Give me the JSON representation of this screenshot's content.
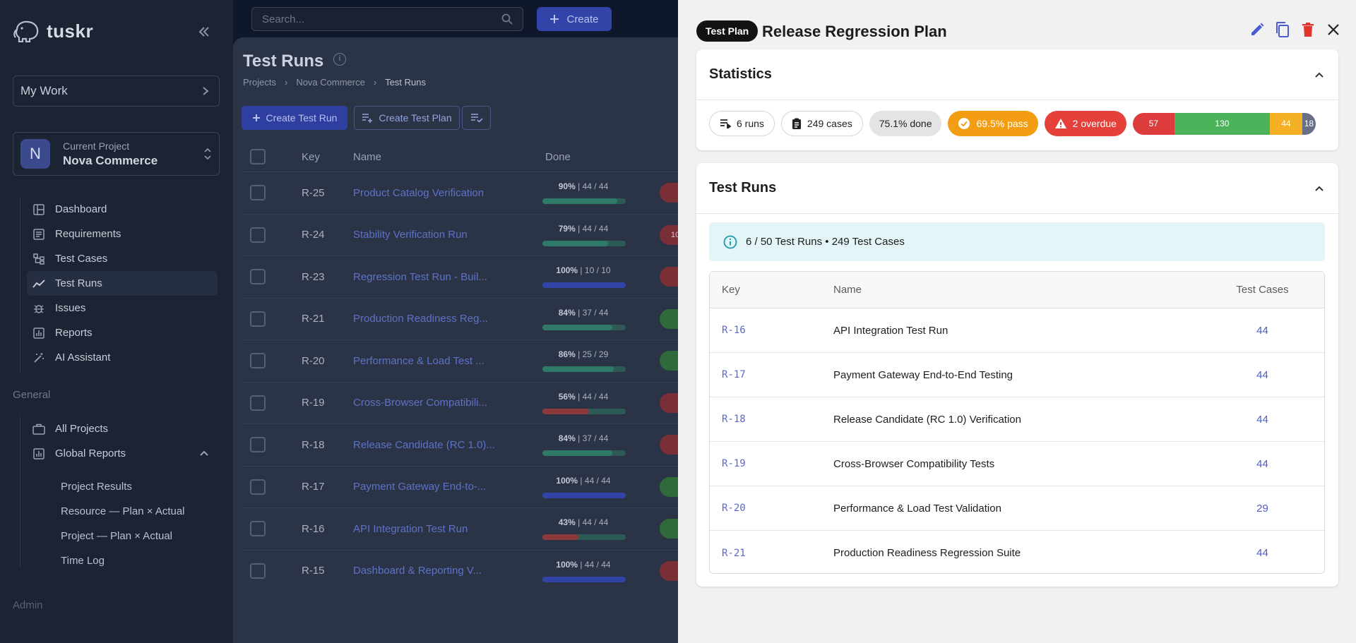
{
  "app": {
    "logo_text": "tuskr"
  },
  "sidebar": {
    "my_work": "My Work",
    "project_label": "Current Project",
    "project_name": "Nova Commerce",
    "project_initial": "N",
    "nav": [
      {
        "label": "Dashboard",
        "icon": "dashboard-icon"
      },
      {
        "label": "Requirements",
        "icon": "requirements-icon"
      },
      {
        "label": "Test Cases",
        "icon": "test-cases-icon"
      },
      {
        "label": "Test Runs",
        "icon": "test-runs-icon",
        "active": true
      },
      {
        "label": "Issues",
        "icon": "bug-icon"
      },
      {
        "label": "Reports",
        "icon": "reports-icon"
      },
      {
        "label": "AI Assistant",
        "icon": "magic-wand-icon"
      }
    ],
    "general_label": "General",
    "general_nav": [
      {
        "label": "All Projects",
        "icon": "briefcase-icon"
      },
      {
        "label": "Global Reports",
        "icon": "reports-icon"
      }
    ],
    "global_reports_sub": [
      "Project Results",
      "Resource — Plan × Actual",
      "Project — Plan × Actual",
      "Time Log"
    ],
    "admin_label": "Admin"
  },
  "topbar": {
    "search_placeholder": "Search...",
    "create_label": "Create"
  },
  "main": {
    "title": "Test Runs",
    "breadcrumb": [
      "Projects",
      "Nova Commerce",
      "Test Runs"
    ],
    "create_test_run": "Create Test Run",
    "create_test_plan": "Create Test Plan",
    "columns": [
      "Key",
      "Name",
      "Done"
    ],
    "runs": [
      {
        "key": "R-25",
        "name": "Product Catalog Verification",
        "pct": "90%",
        "counts": "44 / 44",
        "fill": 0.9,
        "bar_color": "#2f7a66",
        "pill_color": "#7a2e35",
        "pill_text": ""
      },
      {
        "key": "R-24",
        "name": "Stability Verification Run",
        "pct": "79%",
        "counts": "44 / 44",
        "fill": 0.79,
        "bar_color": "#2f7a66",
        "pill_color": "#7a2e35",
        "pill_text": "10"
      },
      {
        "key": "R-23",
        "name": "Regression Test Run - Buil...",
        "pct": "100%",
        "counts": "10 / 10",
        "fill": 1.0,
        "bar_color": "#3243a8",
        "pill_color": "#7a2e35",
        "pill_text": ""
      },
      {
        "key": "R-21",
        "name": "Production Readiness Reg...",
        "pct": "84%",
        "counts": "37 / 44",
        "fill": 0.84,
        "bar_color": "#2f7a66",
        "pill_color": "#2f6a3a",
        "pill_text": ""
      },
      {
        "key": "R-20",
        "name": "Performance & Load Test ...",
        "pct": "86%",
        "counts": "25 / 29",
        "fill": 0.86,
        "bar_color": "#2f7a66",
        "pill_color": "#2f6a3a",
        "pill_text": ""
      },
      {
        "key": "R-19",
        "name": "Cross-Browser Compatibili...",
        "pct": "56%",
        "counts": "44 / 44",
        "fill": 0.56,
        "bar_color": "#8a3a3a",
        "pill_color": "#7a2e35",
        "pill_text": ""
      },
      {
        "key": "R-18",
        "name": "Release Candidate (RC 1.0)...",
        "pct": "84%",
        "counts": "37 / 44",
        "fill": 0.84,
        "bar_color": "#2f7a66",
        "pill_color": "#7a2e35",
        "pill_text": ""
      },
      {
        "key": "R-17",
        "name": "Payment Gateway End-to-...",
        "pct": "100%",
        "counts": "44 / 44",
        "fill": 1.0,
        "bar_color": "#3243a8",
        "pill_color": "#2f6a3a",
        "pill_text": ""
      },
      {
        "key": "R-16",
        "name": "API Integration Test Run",
        "pct": "43%",
        "counts": "44 / 44",
        "fill": 0.43,
        "bar_color": "#8a3a3a",
        "pill_color": "#2f6a3a",
        "pill_text": ""
      },
      {
        "key": "R-15",
        "name": "Dashboard & Reporting V...",
        "pct": "100%",
        "counts": "44 / 44",
        "fill": 1.0,
        "bar_color": "#3243a8",
        "pill_color": "#7a2e35",
        "pill_text": ""
      }
    ]
  },
  "drawer": {
    "badge": "Test Plan",
    "title": "Release Regression Plan",
    "statistics": {
      "title": "Statistics",
      "runs": "6 runs",
      "cases": "249 cases",
      "done": "75.1% done",
      "pass": "69.5% pass",
      "overdue": "2 overdue",
      "distribution": [
        {
          "label": "57",
          "value": 57,
          "color": "#dc3c3c"
        },
        {
          "label": "130",
          "value": 130,
          "color": "#4cb35a"
        },
        {
          "label": "44",
          "value": 44,
          "color": "#f4b024"
        },
        {
          "label": "18",
          "value": 18,
          "color": "#677085"
        }
      ]
    },
    "test_runs": {
      "title": "Test Runs",
      "info": "6 / 50 Test Runs • 249 Test Cases",
      "columns": {
        "key": "Key",
        "name": "Name",
        "test_cases": "Test Cases"
      },
      "rows": [
        {
          "key": "R-16",
          "name": "API Integration Test Run",
          "test_cases": "44"
        },
        {
          "key": "R-17",
          "name": "Payment Gateway End-to-End Testing",
          "test_cases": "44"
        },
        {
          "key": "R-18",
          "name": "Release Candidate (RC 1.0) Verification",
          "test_cases": "44"
        },
        {
          "key": "R-19",
          "name": "Cross-Browser Compatibility Tests",
          "test_cases": "44"
        },
        {
          "key": "R-20",
          "name": "Performance & Load Test Validation",
          "test_cases": "29"
        },
        {
          "key": "R-21",
          "name": "Production Readiness Regression Suite",
          "test_cases": "44"
        }
      ]
    }
  }
}
